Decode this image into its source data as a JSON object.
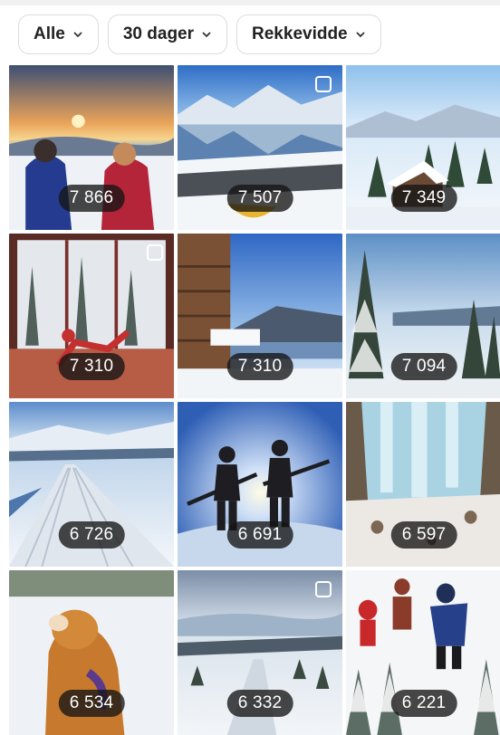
{
  "filters": [
    {
      "label": "Alle"
    },
    {
      "label": "30 dager"
    },
    {
      "label": "Rekkevidde"
    }
  ],
  "posts": [
    {
      "count": "7 866",
      "scene": "sunset-couple"
    },
    {
      "count": "7 507",
      "scene": "lake-reflection",
      "multi": true
    },
    {
      "count": "7 349",
      "scene": "snowy-village"
    },
    {
      "count": "7 310",
      "scene": "window-yoga",
      "multi": true
    },
    {
      "count": "7 310",
      "scene": "cabin-lake"
    },
    {
      "count": "7 094",
      "scene": "snowy-forest"
    },
    {
      "count": "6 726",
      "scene": "ski-tracks"
    },
    {
      "count": "6 691",
      "scene": "skiers-sun"
    },
    {
      "count": "6 597",
      "scene": "ice-waterfall"
    },
    {
      "count": "6 534",
      "scene": "dog-snow"
    },
    {
      "count": "6 332",
      "scene": "winter-road",
      "multi": true
    },
    {
      "count": "6 221",
      "scene": "kids-jumping"
    }
  ],
  "icons": {
    "chevron": "chevron-down-icon",
    "carousel": "carousel-icon"
  }
}
